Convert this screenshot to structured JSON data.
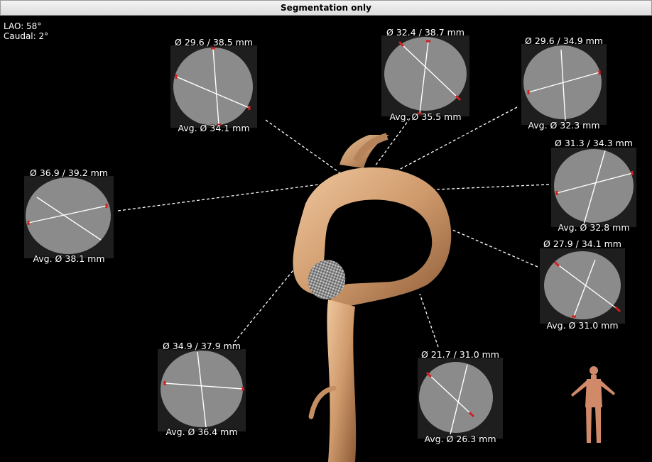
{
  "title": "Segmentation only",
  "view": {
    "angle_primary": "LAO: 58°",
    "angle_secondary": "Caudal: 2°"
  },
  "colors": {
    "vessel": "#cf9a6c",
    "measure_marker": "#d12020",
    "measure_line": "#ffffff",
    "connector": "#ffffff"
  },
  "icons": {
    "orientation": "human-body-orientation-icon"
  },
  "panels": [
    {
      "id": "p1",
      "diameters": "Ø 29.6 / 38.5 mm",
      "average": "Avg. Ø 34.1 mm"
    },
    {
      "id": "p2",
      "diameters": "Ø 32.4 / 38.7 mm",
      "average": "Avg. Ø 35.5 mm"
    },
    {
      "id": "p3",
      "diameters": "Ø 29.6 / 34.9 mm",
      "average": "Avg. Ø 32.3 mm"
    },
    {
      "id": "p4",
      "diameters": "Ø 31.3 / 34.3 mm",
      "average": "Avg. Ø 32.8 mm"
    },
    {
      "id": "p5",
      "diameters": "Ø 27.9 / 34.1 mm",
      "average": "Avg. Ø 31.0 mm"
    },
    {
      "id": "p6",
      "diameters": "Ø 21.7 / 31.0 mm",
      "average": "Avg. Ø 26.3 mm"
    },
    {
      "id": "p7",
      "diameters": "Ø 34.9 / 37.9 mm",
      "average": "Avg. Ø 36.4 mm"
    },
    {
      "id": "p8",
      "diameters": "Ø 36.9 / 39.2 mm",
      "average": "Avg. Ø 38.1 mm"
    }
  ]
}
